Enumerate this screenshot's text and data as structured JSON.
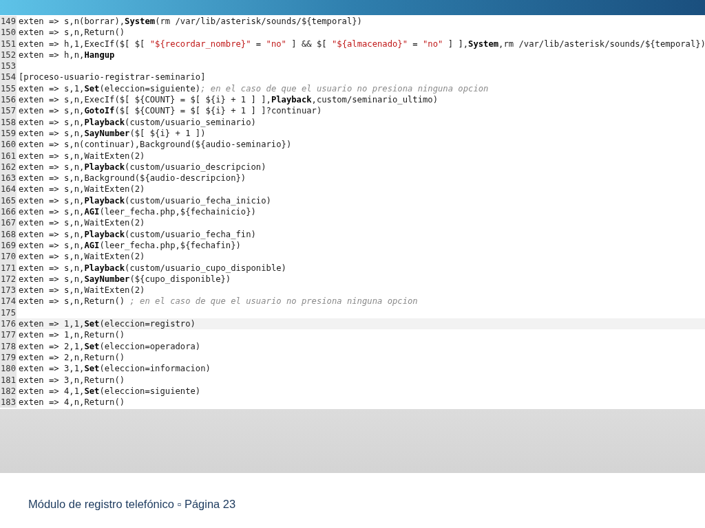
{
  "code_editor": {
    "lines": [
      {
        "number": "149",
        "current": false,
        "segments": [
          {
            "kind": "plain",
            "text": "exten => s,n(borrar),"
          },
          {
            "kind": "keyword",
            "text": "System"
          },
          {
            "kind": "plain",
            "text": "(rm /var/lib/asterisk/sounds/${temporal})"
          }
        ]
      },
      {
        "number": "150",
        "current": false,
        "segments": [
          {
            "kind": "plain",
            "text": "exten => s,n,Return()"
          }
        ]
      },
      {
        "number": "151",
        "current": false,
        "segments": [
          {
            "kind": "plain",
            "text": "exten => h,1,ExecIf($[ $[ "
          },
          {
            "kind": "string",
            "text": "\"${recordar_nombre}\""
          },
          {
            "kind": "plain",
            "text": " = "
          },
          {
            "kind": "string",
            "text": "\"no\""
          },
          {
            "kind": "plain",
            "text": " ] && $[ "
          },
          {
            "kind": "string",
            "text": "\"${almacenado}\""
          },
          {
            "kind": "plain",
            "text": " = "
          },
          {
            "kind": "string",
            "text": "\"no\""
          },
          {
            "kind": "plain",
            "text": " ] ],"
          },
          {
            "kind": "keyword",
            "text": "System"
          },
          {
            "kind": "plain",
            "text": ",rm /var/lib/asterisk/sounds/${temporal})"
          }
        ]
      },
      {
        "number": "152",
        "current": false,
        "segments": [
          {
            "kind": "plain",
            "text": "exten => h,n,"
          },
          {
            "kind": "keyword",
            "text": "Hangup"
          }
        ]
      },
      {
        "number": "153",
        "current": false
      },
      {
        "number": "154",
        "current": false,
        "segments": [
          {
            "kind": "plain",
            "text": "[proceso-usuario-registrar-seminario]"
          }
        ]
      },
      {
        "number": "155",
        "current": false,
        "segments": [
          {
            "kind": "plain",
            "text": "exten => s,1,"
          },
          {
            "kind": "keyword",
            "text": "Set"
          },
          {
            "kind": "plain",
            "text": "(eleccion=siguiente)"
          },
          {
            "kind": "comment",
            "text": "; en el caso de que el usuario no presiona ninguna opcion"
          }
        ]
      },
      {
        "number": "156",
        "current": false,
        "segments": [
          {
            "kind": "plain",
            "text": "exten => s,n,ExecIf($[ ${COUNT} = $[ ${i} + 1 ] ],"
          },
          {
            "kind": "keyword",
            "text": "Playback"
          },
          {
            "kind": "plain",
            "text": ",custom/seminario_ultimo)"
          }
        ]
      },
      {
        "number": "157",
        "current": false,
        "segments": [
          {
            "kind": "plain",
            "text": "exten => s,n,"
          },
          {
            "kind": "keyword",
            "text": "GotoIf"
          },
          {
            "kind": "plain",
            "text": "($[ ${COUNT} = $[ ${i} + 1 ] ]?continuar)"
          }
        ]
      },
      {
        "number": "158",
        "current": false,
        "segments": [
          {
            "kind": "plain",
            "text": "exten => s,n,"
          },
          {
            "kind": "keyword",
            "text": "Playback"
          },
          {
            "kind": "plain",
            "text": "(custom/usuario_seminario)"
          }
        ]
      },
      {
        "number": "159",
        "current": false,
        "segments": [
          {
            "kind": "plain",
            "text": "exten => s,n,"
          },
          {
            "kind": "keyword",
            "text": "SayNumber"
          },
          {
            "kind": "plain",
            "text": "($[ ${i} + 1 ])"
          }
        ]
      },
      {
        "number": "160",
        "current": false,
        "segments": [
          {
            "kind": "plain",
            "text": "exten => s,n(continuar),Background(${audio-seminario})"
          }
        ]
      },
      {
        "number": "161",
        "current": false,
        "segments": [
          {
            "kind": "plain",
            "text": "exten => s,n,WaitExten(2)"
          }
        ]
      },
      {
        "number": "162",
        "current": false,
        "segments": [
          {
            "kind": "plain",
            "text": "exten => s,n,"
          },
          {
            "kind": "keyword",
            "text": "Playback"
          },
          {
            "kind": "plain",
            "text": "(custom/usuario_descripcion)"
          }
        ]
      },
      {
        "number": "163",
        "current": false,
        "segments": [
          {
            "kind": "plain",
            "text": "exten => s,n,Background(${audio-descripcion})"
          }
        ]
      },
      {
        "number": "164",
        "current": false,
        "segments": [
          {
            "kind": "plain",
            "text": "exten => s,n,WaitExten(2)"
          }
        ]
      },
      {
        "number": "165",
        "current": false,
        "segments": [
          {
            "kind": "plain",
            "text": "exten => s,n,"
          },
          {
            "kind": "keyword",
            "text": "Playback"
          },
          {
            "kind": "plain",
            "text": "(custom/usuario_fecha_inicio)"
          }
        ]
      },
      {
        "number": "166",
        "current": false,
        "segments": [
          {
            "kind": "plain",
            "text": "exten => s,n,"
          },
          {
            "kind": "keyword",
            "text": "AGI"
          },
          {
            "kind": "plain",
            "text": "(leer_fecha.php,${fechainicio})"
          }
        ]
      },
      {
        "number": "167",
        "current": false,
        "segments": [
          {
            "kind": "plain",
            "text": "exten => s,n,WaitExten(2)"
          }
        ]
      },
      {
        "number": "168",
        "current": false,
        "segments": [
          {
            "kind": "plain",
            "text": "exten => s,n,"
          },
          {
            "kind": "keyword",
            "text": "Playback"
          },
          {
            "kind": "plain",
            "text": "(custom/usuario_fecha_fin)"
          }
        ]
      },
      {
        "number": "169",
        "current": false,
        "segments": [
          {
            "kind": "plain",
            "text": "exten => s,n,"
          },
          {
            "kind": "keyword",
            "text": "AGI"
          },
          {
            "kind": "plain",
            "text": "(leer_fecha.php,${fechafin})"
          }
        ]
      },
      {
        "number": "170",
        "current": false,
        "segments": [
          {
            "kind": "plain",
            "text": "exten => s,n,WaitExten(2)"
          }
        ]
      },
      {
        "number": "171",
        "current": false,
        "segments": [
          {
            "kind": "plain",
            "text": "exten => s,n,"
          },
          {
            "kind": "keyword",
            "text": "Playback"
          },
          {
            "kind": "plain",
            "text": "(custom/usuario_cupo_disponible)"
          }
        ]
      },
      {
        "number": "172",
        "current": false,
        "segments": [
          {
            "kind": "plain",
            "text": "exten => s,n,"
          },
          {
            "kind": "keyword",
            "text": "SayNumber"
          },
          {
            "kind": "plain",
            "text": "(${cupo_disponible})"
          }
        ]
      },
      {
        "number": "173",
        "current": false,
        "segments": [
          {
            "kind": "plain",
            "text": "exten => s,n,WaitExten(2)"
          }
        ]
      },
      {
        "number": "174",
        "current": false,
        "segments": [
          {
            "kind": "plain",
            "text": "exten => s,n,Return() "
          },
          {
            "kind": "comment",
            "text": "; en el caso de que el usuario no presiona ninguna opcion"
          }
        ]
      },
      {
        "number": "175",
        "current": false
      },
      {
        "number": "176",
        "current": true,
        "segments": [
          {
            "kind": "plain",
            "text": "exten => 1,1,"
          },
          {
            "kind": "keyword",
            "text": "Set"
          },
          {
            "kind": "plain",
            "text": "(eleccion=registro)"
          }
        ]
      },
      {
        "number": "177",
        "current": false,
        "segments": [
          {
            "kind": "plain",
            "text": "exten => 1,n,Return()"
          }
        ]
      },
      {
        "number": "178",
        "current": false,
        "segments": [
          {
            "kind": "plain",
            "text": "exten => 2,1,"
          },
          {
            "kind": "keyword",
            "text": "Set"
          },
          {
            "kind": "plain",
            "text": "(eleccion=operadora)"
          }
        ]
      },
      {
        "number": "179",
        "current": false,
        "segments": [
          {
            "kind": "plain",
            "text": "exten => 2,n,Return()"
          }
        ]
      },
      {
        "number": "180",
        "current": false,
        "segments": [
          {
            "kind": "plain",
            "text": "exten => 3,1,"
          },
          {
            "kind": "keyword",
            "text": "Set"
          },
          {
            "kind": "plain",
            "text": "(eleccion=informacion)"
          }
        ]
      },
      {
        "number": "181",
        "current": false,
        "segments": [
          {
            "kind": "plain",
            "text": "exten => 3,n,Return()"
          }
        ]
      },
      {
        "number": "182",
        "current": false,
        "segments": [
          {
            "kind": "plain",
            "text": "exten => 4,1,"
          },
          {
            "kind": "keyword",
            "text": "Set"
          },
          {
            "kind": "plain",
            "text": "(eleccion=siguiente)"
          }
        ]
      },
      {
        "number": "183",
        "current": false,
        "segments": [
          {
            "kind": "plain",
            "text": "exten => 4,n,Return()"
          }
        ]
      }
    ]
  },
  "footer": {
    "text": "Módulo de registro telefónico ▫ Página 23"
  }
}
